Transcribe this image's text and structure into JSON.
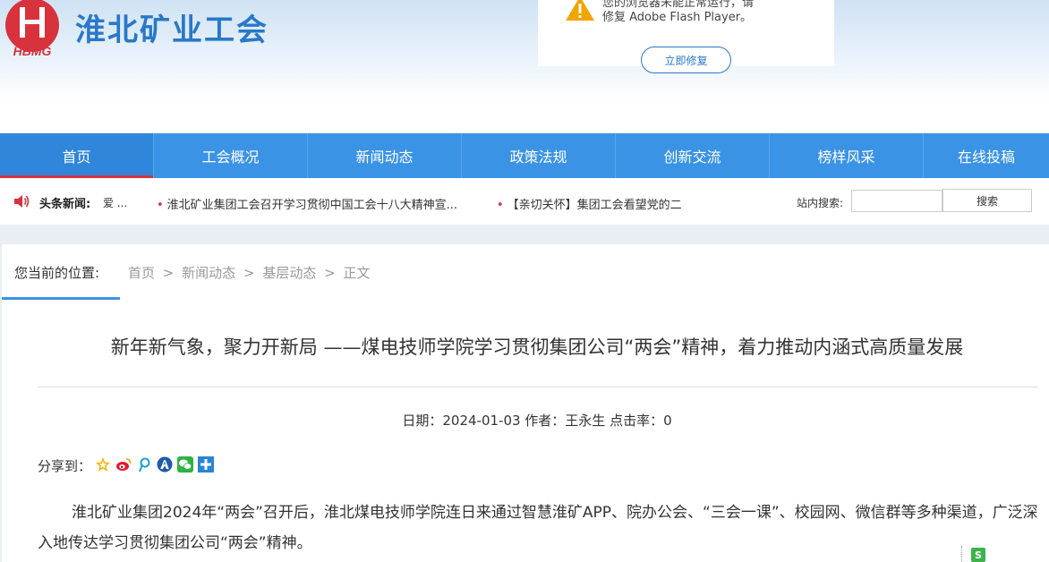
{
  "header": {
    "logo_text": "HBMG",
    "site_title": "淮北矿业工会"
  },
  "flash_popup": {
    "line1": "您的浏览器未能正常运行，请",
    "line2": "修复 Adobe Flash Player。",
    "button": "立即修复"
  },
  "nav": {
    "items": [
      {
        "label": "首页"
      },
      {
        "label": "工会概况"
      },
      {
        "label": "新闻动态"
      },
      {
        "label": "政策法规"
      },
      {
        "label": "创新交流"
      },
      {
        "label": "榜样风采"
      },
      {
        "label": "在线投稿"
      }
    ]
  },
  "newsbar": {
    "label": "头条新闻:",
    "snippet": "爱 ...",
    "items": [
      "淮北矿业集团工会召开学习贯彻中国工会十八大精神宣...",
      "【亲切关怀】集团工会看望党的二"
    ],
    "search_label": "站内搜索:",
    "search_button": "搜索"
  },
  "breadcrumb": {
    "label": "您当前的位置:",
    "items": [
      "首页",
      ">",
      "新闻动态",
      ">",
      "基层动态",
      ">",
      "正文"
    ]
  },
  "article": {
    "title": "新年新气象，聚力开新局 ——煤电技师学院学习贯彻集团公司“两会”精神，着力推动内涵式高质量发展",
    "meta": "日期：2024-01-03 作者：王永生 点击率：0",
    "share_label": "分享到：",
    "share_icons": [
      "qzone-icon",
      "weibo-icon",
      "tencent-weibo-icon",
      "renren-icon",
      "wechat-icon",
      "more-share-icon"
    ],
    "paragraph": "淮北矿业集团2024年“两会”召开后，淮北煤电技师学院连日来通过智慧淮矿APP、院办公会、“三会一课”、校园网、微信群等多种渠道，广泛深入地传达学习贯彻集团公司“两会”精神。"
  },
  "side_widget": {
    "icon": "S"
  },
  "colors": {
    "primary": "#3b93e6",
    "accent_red": "#d8323c",
    "title_blue": "#2a78c8"
  }
}
